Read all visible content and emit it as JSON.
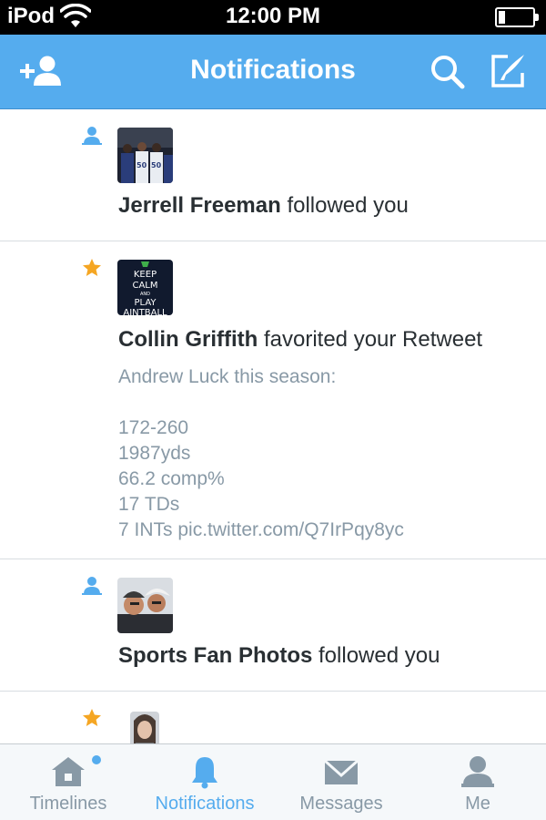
{
  "status_bar": {
    "carrier": "iPod",
    "time": "12:00 PM"
  },
  "nav": {
    "title": "Notifications",
    "add_user_icon": "add-user-icon",
    "search_icon": "search-icon",
    "compose_icon": "compose-icon"
  },
  "notifications": [
    {
      "type": "follow",
      "type_icon": "person-icon",
      "avatar": "football-players-photo",
      "user": "Jerrell Freeman",
      "action": " followed you"
    },
    {
      "type": "favorite",
      "type_icon": "star-icon",
      "avatar": "keep-calm-poster",
      "avatar_text": [
        "KEEP",
        "CALM",
        "AND",
        "PLAY",
        "AINTBALL"
      ],
      "user": "Collin Griffith",
      "action": " favorited your Retweet",
      "tweet": "Andrew Luck this season:\n\n172-260\n1987yds\n66.2 comp%\n17 TDs\n7 INTs pic.twitter.com/Q7IrPqy8yc"
    },
    {
      "type": "follow",
      "type_icon": "person-icon",
      "avatar": "two-men-selfie-photo",
      "user": "Sports Fan Photos",
      "action": " followed you"
    },
    {
      "type": "favorite",
      "type_icon": "star-icon",
      "avatar": "woman-portrait-photo"
    }
  ],
  "tabs": [
    {
      "label": "Timelines",
      "icon": "home-icon",
      "active": false,
      "has_dot": true
    },
    {
      "label": "Notifications",
      "icon": "bell-icon",
      "active": true
    },
    {
      "label": "Messages",
      "icon": "envelope-icon",
      "active": false
    },
    {
      "label": "Me",
      "icon": "person-icon",
      "active": false
    }
  ],
  "colors": {
    "brand_blue": "#55acee",
    "favorite_orange": "#f5a623",
    "muted_text": "#8899a6",
    "tab_inactive": "#8899a6"
  }
}
